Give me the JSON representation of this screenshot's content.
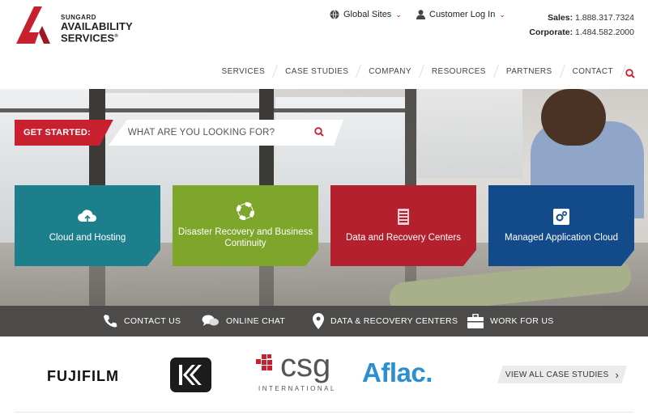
{
  "brand": {
    "small": "SUNGARD",
    "line1": "AVAILABILITY",
    "line2": "SERVICES",
    "reg": "®",
    "red": "#c8202f"
  },
  "utility": {
    "global_sites": "Global Sites",
    "customer_login": "Customer Log In",
    "sales_label": "Sales:",
    "sales_phone": "1.888.317.7324",
    "corporate_label": "Corporate:",
    "corporate_phone": "1.484.582.2000"
  },
  "nav": {
    "items": [
      "SERVICES",
      "CASE STUDIES",
      "COMPANY",
      "RESOURCES",
      "PARTNERS",
      "CONTACT"
    ],
    "search_icon": "search-icon"
  },
  "hero": {
    "get_started": "GET STARTED:",
    "search_placeholder": "WHAT ARE YOU LOOKING FOR?",
    "tiles": [
      {
        "label": "Cloud and Hosting",
        "icon": "cloud-upload-icon",
        "color": "#1d7f8c"
      },
      {
        "label": "Disaster Recovery and Business Continuity",
        "icon": "lifebuoy-icon",
        "color": "#7da62a"
      },
      {
        "label": "Data and Recovery Centers",
        "icon": "server-rack-icon",
        "color": "#b5202e"
      },
      {
        "label": "Managed Application Cloud",
        "icon": "gears-icon",
        "color": "#134a8a"
      }
    ]
  },
  "strip": {
    "items": [
      {
        "label": "CONTACT US",
        "icon": "phone-icon"
      },
      {
        "label": "ONLINE CHAT",
        "icon": "chat-bubbles-icon"
      },
      {
        "label": "DATA & RECOVERY CENTERS",
        "icon": "map-pin-icon"
      },
      {
        "label": "WORK FOR US",
        "icon": "briefcase-icon"
      }
    ]
  },
  "customers": {
    "fujifilm": "FUJIFILM",
    "csg": "csg",
    "csg_sub": "INTERNATIONAL",
    "aflac": "Aflac.",
    "view_all": "VIEW ALL CASE STUDIES"
  }
}
